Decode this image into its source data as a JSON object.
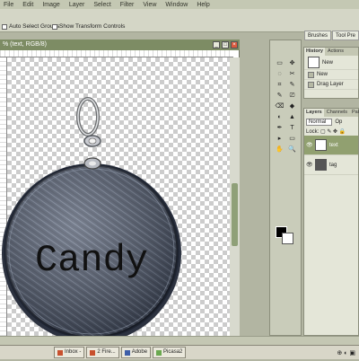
{
  "menu": {
    "items": [
      "File",
      "Edit",
      "Image",
      "Layer",
      "Select",
      "Filter",
      "View",
      "Window",
      "Help"
    ]
  },
  "options": {
    "auto_select": "Auto Select Groups",
    "transform": "Show Transform Controls"
  },
  "palette_well": {
    "tabs": [
      "Brushes",
      "Tool Pre"
    ]
  },
  "document": {
    "title": "% (text, RGB/8)",
    "tag_text": "Candy"
  },
  "history": {
    "tabs": [
      "History",
      "Actions"
    ],
    "items": [
      "New",
      "New",
      "Drag Layer"
    ]
  },
  "layers": {
    "tabs": [
      "Layers",
      "Channels",
      "Paths"
    ],
    "blend_mode": "Normal",
    "opacity_label": "Op",
    "lock_label": "Lock:",
    "rows": [
      {
        "thumb": "T",
        "name": "text"
      },
      {
        "thumb": "",
        "name": "tag"
      }
    ]
  },
  "tools": [
    "▭",
    "✥",
    "◌",
    "✂",
    "⌗",
    "✎",
    "✎",
    "⎚",
    "⌫",
    "◆",
    "◐",
    "▲",
    "✒",
    "T",
    "▸",
    "▭",
    "✋",
    "🔍"
  ],
  "taskbar": {
    "items": [
      "Inbox -",
      "2 Fire...",
      "Adobe",
      "Picasa2"
    ]
  },
  "colors": {
    "fg": "#000000",
    "bg": "#ffffff",
    "accent": "#91a070"
  }
}
